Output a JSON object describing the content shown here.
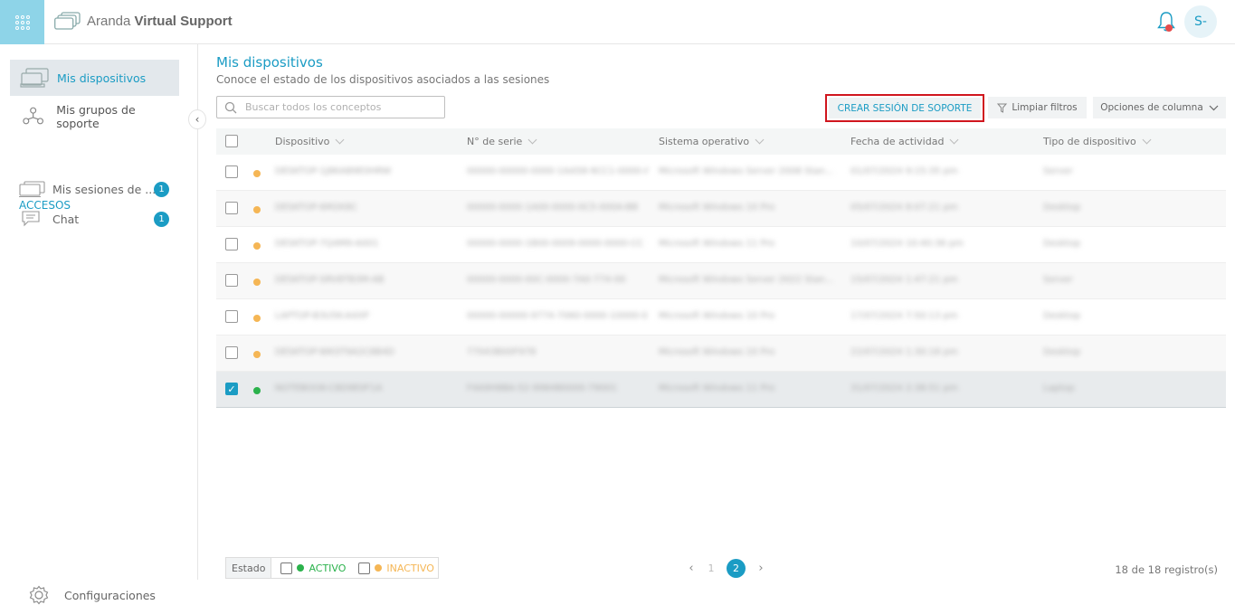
{
  "app": {
    "title_light": "Aranda",
    "title_bold": "Virtual Support"
  },
  "user": {
    "avatar_initials": "S-"
  },
  "sidebar": {
    "items": [
      {
        "label": "Mis dispositivos",
        "icon": "devices-icon",
        "active": true
      },
      {
        "label": "Mis grupos de soporte",
        "icon": "support-groups-icon",
        "active": false
      }
    ],
    "section_label": "ACCESOS",
    "accesos": [
      {
        "label": "Mis sesiones de ...",
        "icon": "sessions-icon",
        "badge": "1"
      },
      {
        "label": "Chat",
        "icon": "chat-icon",
        "badge": "1"
      }
    ],
    "settings_label": "Configuraciones"
  },
  "page": {
    "title": "Mis dispositivos",
    "subtitle": "Conoce el estado de los dispositivos asociados a las sesiones"
  },
  "toolbar": {
    "search_placeholder": "Buscar todos los conceptos",
    "create_label": "CREAR SESIÓN DE SOPORTE",
    "clear_label": "Limpiar filtros",
    "columns_label": "Opciones de columna"
  },
  "table": {
    "headers": [
      "Dispositivo",
      "N° de serie",
      "Sistema operativo",
      "Fecha de actividad",
      "Tipo de dispositivo"
    ],
    "rows": [
      {
        "status": "inactive",
        "checked": false,
        "cells": [
          "DESKTOP-1J8KAB9E0HRW",
          "00000-00000-0000-1AA58-9CC1-0000-AA",
          "Microsoft Windows Server 2008 Stan...",
          "01/07/2024 9:15:35 pm",
          "Server"
        ]
      },
      {
        "status": "inactive",
        "checked": false,
        "cells": [
          "DESKTOP-6M2K8C",
          "00000-0000-1A00-0000-0C5-000A-BB",
          "Microsoft Windows 10 Pro",
          "05/07/2024 8:07:21 pm",
          "Desktop"
        ]
      },
      {
        "status": "inactive",
        "checked": false,
        "cells": [
          "DESKTOP-7Q4M9-A001",
          "00000-0000-1B00-0009-0000-0000-CC",
          "Microsoft Windows 11 Pro",
          "10/07/2024 10:40:36 pm",
          "Desktop"
        ]
      },
      {
        "status": "inactive",
        "checked": false,
        "cells": [
          "DESKTOP-SRV8TB3M-AB",
          "00000-0000-00C-0000-7A0-774-00",
          "Microsoft Windows Server 2022 Stan...",
          "15/07/2024 1:47:21 pm",
          "Server"
        ]
      },
      {
        "status": "inactive",
        "checked": false,
        "cells": [
          "LAPTOP-B3U5K-A4XP",
          "00000-00000-9774-7060-0000-10000-00",
          "Microsoft Windows 10 Pro",
          "17/07/2024 7:50:13 pm",
          "Desktop"
        ]
      },
      {
        "status": "inactive",
        "checked": false,
        "cells": [
          "DESKTOP-WKST9A2C8B4D",
          "77043B00F978",
          "Microsoft Windows 10 Pro",
          "22/07/2024 1:30:18 pm",
          "Desktop"
        ]
      },
      {
        "status": "active",
        "checked": true,
        "cells": [
          "NOTEBOOK-C8D9E0F1A",
          "F4A9H8BA-52-9984B0000-79001",
          "Microsoft Windows 11 Pro",
          "31/07/2024 2:38:51 pm",
          "Laptop"
        ]
      }
    ]
  },
  "footer": {
    "state_label": "Estado",
    "active_label": "ACTIVO",
    "inactive_label": "INACTIVO",
    "pages": [
      "1",
      "2"
    ],
    "current_page": "2",
    "records": "18 de 18 registro(s)"
  },
  "colors": {
    "accent": "#1b9cc4",
    "active": "#2bb24c",
    "inactive": "#f5b655",
    "highlight_border": "#d0161e"
  }
}
